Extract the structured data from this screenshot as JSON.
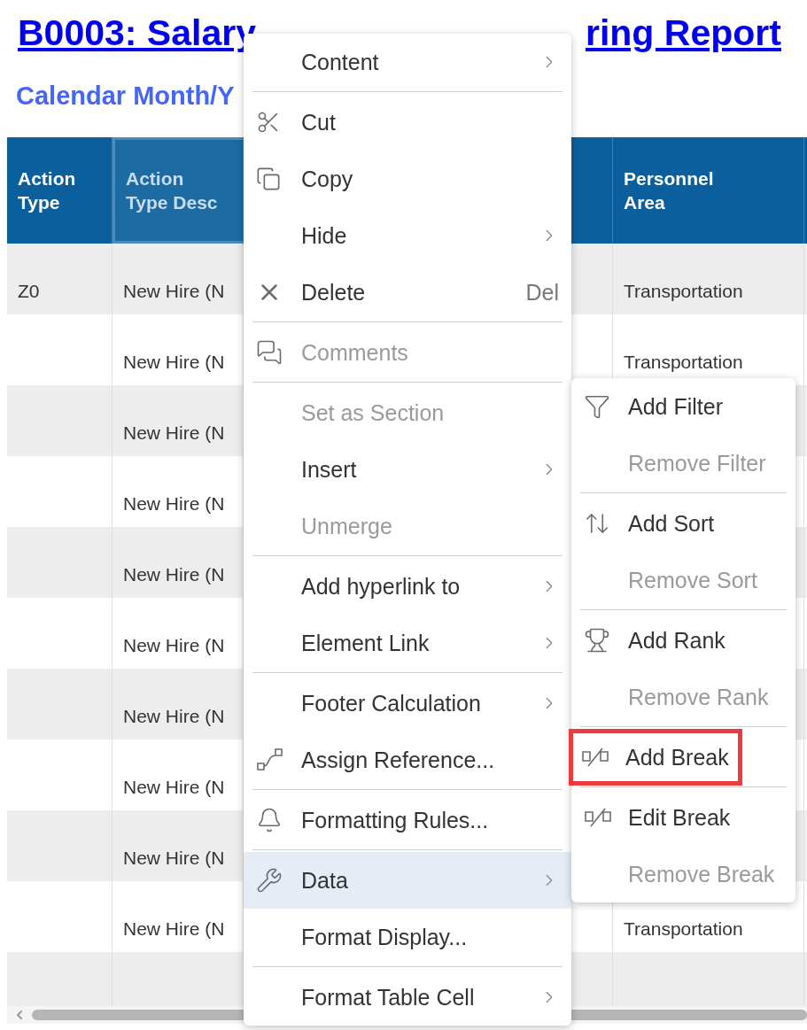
{
  "report": {
    "title_parts": [
      "B0003: Salary",
      "ring Report"
    ],
    "subtitle": "Calendar Month/Y"
  },
  "table": {
    "columns": [
      {
        "label": "Action\nType",
        "selected": false
      },
      {
        "label": "Action\nType Desc",
        "selected": true
      },
      {
        "selected": false
      },
      {
        "label": "Personnel\nArea",
        "selected": false
      },
      {
        "selected": false
      }
    ],
    "rows": [
      {
        "cells": [
          "Z0",
          "New Hire (N",
          null,
          "Transportation",
          null
        ]
      },
      {
        "cells": [
          null,
          "New Hire (N",
          null,
          "Transportation",
          null
        ]
      },
      {
        "cells": [
          null,
          "New Hire (N",
          null,
          null,
          null
        ]
      },
      {
        "cells": [
          null,
          "New Hire (N",
          null,
          null,
          null
        ]
      },
      {
        "cells": [
          null,
          "New Hire (N",
          null,
          null,
          null
        ]
      },
      {
        "cells": [
          null,
          "New Hire (N",
          null,
          null,
          null
        ]
      },
      {
        "cells": [
          null,
          "New Hire (N",
          null,
          null,
          null
        ]
      },
      {
        "cells": [
          null,
          "New Hire (N",
          null,
          null,
          null
        ]
      },
      {
        "cells": [
          null,
          "New Hire (N",
          null,
          null,
          null
        ]
      },
      {
        "cells": [
          null,
          "New Hire (N",
          null,
          "Transportation",
          null
        ]
      },
      {
        "cells": [
          null,
          null,
          null,
          null,
          null
        ]
      }
    ]
  },
  "context_menu": {
    "items": [
      {
        "kind": "item",
        "label": "Content",
        "submenu": true,
        "disabled": false,
        "selected": false
      },
      {
        "kind": "separator"
      },
      {
        "kind": "item",
        "label": "Cut",
        "submenu": false,
        "disabled": false,
        "selected": false
      },
      {
        "kind": "item",
        "label": "Copy",
        "submenu": false,
        "disabled": false,
        "selected": false
      },
      {
        "kind": "item",
        "label": "Hide",
        "submenu": true,
        "disabled": false,
        "selected": false
      },
      {
        "kind": "item",
        "label": "Delete",
        "shortcut": "Del",
        "submenu": false,
        "disabled": false,
        "selected": false
      },
      {
        "kind": "separator"
      },
      {
        "kind": "item",
        "label": "Comments",
        "submenu": false,
        "disabled": true,
        "selected": false
      },
      {
        "kind": "separator"
      },
      {
        "kind": "item",
        "label": "Set as Section",
        "submenu": false,
        "disabled": true,
        "selected": false
      },
      {
        "kind": "item",
        "label": "Insert",
        "submenu": true,
        "disabled": false,
        "selected": false
      },
      {
        "kind": "item",
        "label": "Unmerge",
        "submenu": false,
        "disabled": true,
        "selected": false
      },
      {
        "kind": "separator"
      },
      {
        "kind": "item",
        "label": "Add hyperlink to",
        "submenu": true,
        "disabled": false,
        "selected": false
      },
      {
        "kind": "item",
        "label": "Element Link",
        "submenu": true,
        "disabled": false,
        "selected": false
      },
      {
        "kind": "separator"
      },
      {
        "kind": "item",
        "label": "Footer Calculation",
        "submenu": true,
        "disabled": false,
        "selected": false
      },
      {
        "kind": "item",
        "label": "Assign Reference...",
        "submenu": false,
        "disabled": false,
        "selected": false
      },
      {
        "kind": "separator"
      },
      {
        "kind": "item",
        "label": "Formatting Rules...",
        "submenu": false,
        "disabled": false,
        "selected": false
      },
      {
        "kind": "separator"
      },
      {
        "kind": "item",
        "label": "Data",
        "submenu": true,
        "disabled": false,
        "selected": true
      },
      {
        "kind": "item",
        "label": "Format Display...",
        "submenu": false,
        "disabled": false,
        "selected": false
      },
      {
        "kind": "separator"
      },
      {
        "kind": "item",
        "label": "Format Table Cell",
        "submenu": true,
        "disabled": false,
        "selected": false
      }
    ]
  },
  "data_submenu": {
    "items": [
      {
        "kind": "item",
        "label": "Add Filter",
        "disabled": false,
        "highlighted": false
      },
      {
        "kind": "item",
        "label": "Remove Filter",
        "disabled": true,
        "highlighted": false
      },
      {
        "kind": "separator"
      },
      {
        "kind": "item",
        "label": "Add Sort",
        "disabled": false,
        "highlighted": false
      },
      {
        "kind": "item",
        "label": "Remove Sort",
        "disabled": true,
        "highlighted": false
      },
      {
        "kind": "separator"
      },
      {
        "kind": "item",
        "label": "Add Rank",
        "disabled": false,
        "highlighted": false
      },
      {
        "kind": "item",
        "label": "Remove Rank",
        "disabled": true,
        "highlighted": false
      },
      {
        "kind": "separator"
      },
      {
        "kind": "item",
        "label": "Add Break",
        "disabled": false,
        "highlighted": true
      },
      {
        "kind": "separator"
      },
      {
        "kind": "item",
        "label": "Edit Break",
        "disabled": false,
        "highlighted": false
      },
      {
        "kind": "item",
        "label": "Remove Break",
        "disabled": true,
        "highlighted": false
      }
    ]
  }
}
